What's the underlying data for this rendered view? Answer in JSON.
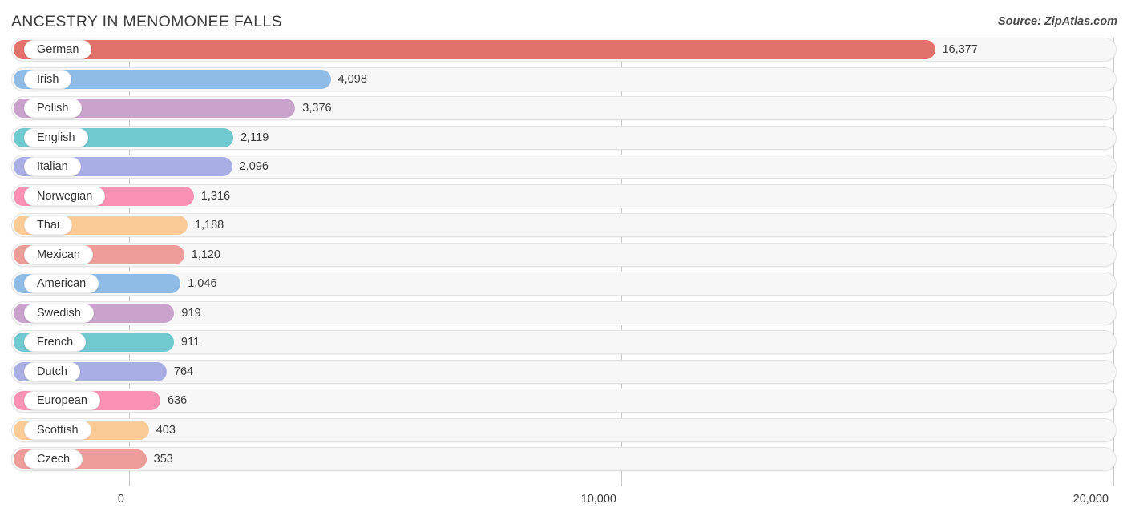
{
  "header": {
    "title": "ANCESTRY IN MENOMONEE FALLS",
    "source": "Source: ZipAtlas.com"
  },
  "chart_data": {
    "type": "bar",
    "orientation": "horizontal",
    "title": "ANCESTRY IN MENOMONEE FALLS",
    "subtitle": "",
    "xlabel": "",
    "ylabel": "",
    "xlim": [
      0,
      20000
    ],
    "grid": true,
    "legend": false,
    "xticks": [
      "0",
      "10,000",
      "20,000"
    ],
    "xtick_values": [
      0,
      10000,
      20000
    ],
    "categories": [
      "German",
      "Irish",
      "Polish",
      "English",
      "Italian",
      "Norwegian",
      "Thai",
      "Mexican",
      "American",
      "Swedish",
      "French",
      "Dutch",
      "European",
      "Scottish",
      "Czech"
    ],
    "values": [
      16377,
      4098,
      3376,
      2119,
      2096,
      1316,
      1188,
      1120,
      1046,
      919,
      911,
      764,
      636,
      403,
      353
    ],
    "value_labels": [
      "16,377",
      "4,098",
      "3,376",
      "2,119",
      "2,096",
      "1,316",
      "1,188",
      "1,120",
      "1,046",
      "919",
      "911",
      "764",
      "636",
      "403",
      "353"
    ],
    "colors": [
      "#E2706B",
      "#8FBCE6",
      "#C9A3CC",
      "#6FC9CF",
      "#A9AEE4",
      "#F891B4",
      "#FBCB96",
      "#EE9C99",
      "#8FBCE6",
      "#C9A3CC",
      "#6FC9CF",
      "#A9AEE4",
      "#F891B4",
      "#FBCB96",
      "#EE9C99"
    ]
  },
  "axis": {
    "ticks": [
      {
        "label": "0",
        "value": 0
      },
      {
        "label": "10,000",
        "value": 10000
      },
      {
        "label": "20,000",
        "value": 20000
      }
    ]
  }
}
